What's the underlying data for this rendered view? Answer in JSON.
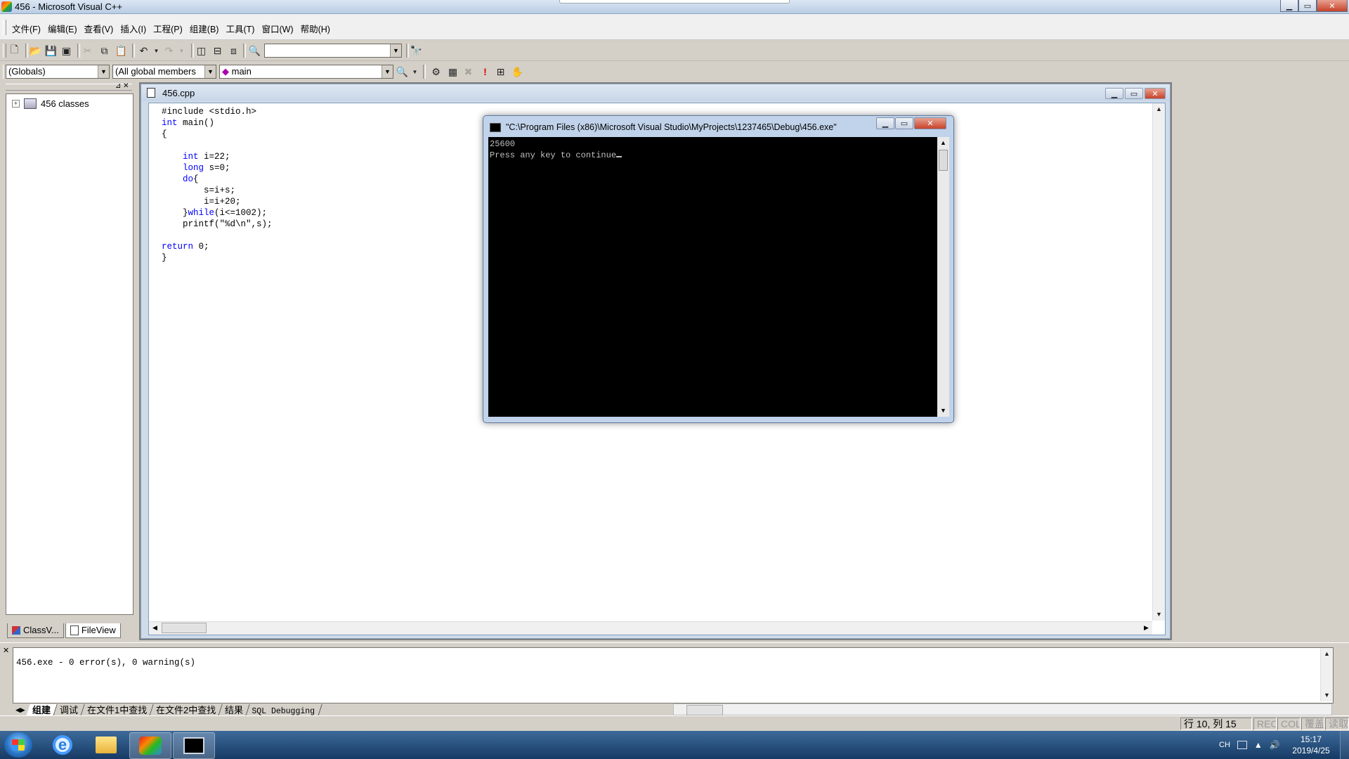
{
  "window": {
    "title": "456 - Microsoft Visual C++",
    "buttons": {
      "minimize": "▁",
      "maximize": "▭",
      "close": "✕"
    }
  },
  "menu": {
    "items": [
      "文件(F)",
      "编辑(E)",
      "查看(V)",
      "插入(I)",
      "工程(P)",
      "组建(B)",
      "工具(T)",
      "窗口(W)",
      "帮助(H)"
    ]
  },
  "toolbar": {
    "find_combo_value": "",
    "icons": [
      "new-file-icon",
      "open-icon",
      "save-icon",
      "save-all-icon",
      "cut-icon",
      "copy-icon",
      "paste-icon",
      "undo-icon",
      "redo-icon",
      "workspace-icon",
      "output-icon",
      "window-list-icon",
      "find-in-files-icon",
      "search-icon"
    ]
  },
  "wizardbar": {
    "scope": "(Globals)",
    "members": "(All global members",
    "function": "main",
    "icons": [
      "wizard-action-icon",
      "compile-icon",
      "build-icon",
      "stop-build-icon",
      "execute-icon",
      "go-icon",
      "breakpoint-icon"
    ]
  },
  "workspace": {
    "tree_root": "456 classes",
    "expander": "+",
    "tabs": [
      "ClassV...",
      "FileView"
    ]
  },
  "editor": {
    "tab_title": "456.cpp",
    "code_lines": [
      [
        {
          "t": "#include <stdio.h>",
          "k": false
        }
      ],
      [
        {
          "t": "int",
          "k": true
        },
        {
          "t": " main()",
          "k": false
        }
      ],
      [
        {
          "t": "{",
          "k": false
        }
      ],
      [
        {
          "t": "",
          "k": false
        }
      ],
      [
        {
          "t": "    ",
          "k": false
        },
        {
          "t": "int",
          "k": true
        },
        {
          "t": " i=22;",
          "k": false
        }
      ],
      [
        {
          "t": "    ",
          "k": false
        },
        {
          "t": "long",
          "k": true
        },
        {
          "t": " s=0;",
          "k": false
        }
      ],
      [
        {
          "t": "    ",
          "k": false
        },
        {
          "t": "do",
          "k": true
        },
        {
          "t": "{",
          "k": false
        }
      ],
      [
        {
          "t": "        s=i+s;",
          "k": false
        }
      ],
      [
        {
          "t": "        i=i+20;",
          "k": false
        }
      ],
      [
        {
          "t": "    }",
          "k": false
        },
        {
          "t": "while",
          "k": true
        },
        {
          "t": "(i<=1002);",
          "k": false
        }
      ],
      [
        {
          "t": "    printf(\"%d\\n\",s);",
          "k": false
        }
      ],
      [
        {
          "t": "",
          "k": false
        }
      ],
      [
        {
          "t": "return",
          "k": true
        },
        {
          "t": " 0;",
          "k": false
        }
      ],
      [
        {
          "t": "}",
          "k": false
        }
      ]
    ]
  },
  "console": {
    "title": "\"C:\\Program Files (x86)\\Microsoft Visual Studio\\MyProjects\\1237465\\Debug\\456.exe\"",
    "output_line1": "25600",
    "output_line2": "Press any key to continue"
  },
  "output": {
    "message": "456.exe - 0 error(s), 0 warning(s)",
    "tabs": [
      "组建",
      "调试",
      "在文件1中查找",
      "在文件2中查找",
      "结果",
      "SQL Debugging"
    ]
  },
  "statusbar": {
    "position": "行 10, 列 15",
    "rec": "REC",
    "col": "COL",
    "ovr": "覆盖",
    "read": "读取"
  },
  "taskbar": {
    "lang": "CH",
    "time": "15:17",
    "date": "2019/4/25",
    "apps": [
      "ie-icon",
      "folder-icon",
      "visual-cpp-icon",
      "console-icon"
    ]
  },
  "colors": {
    "keyword": "#0000ff",
    "console_bg": "#000000",
    "console_text": "#c0c0c0"
  }
}
